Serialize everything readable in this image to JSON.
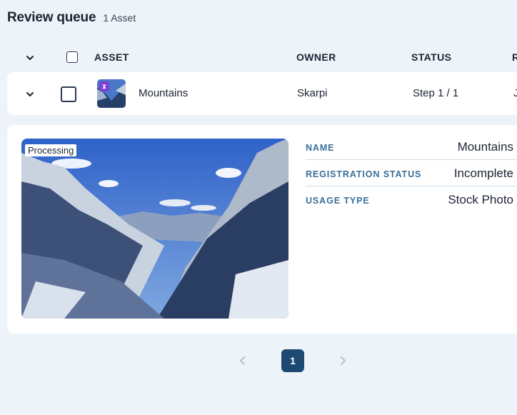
{
  "header": {
    "title": "Review queue",
    "count": "1 Asset"
  },
  "table": {
    "columns": [
      "ASSET",
      "OWNER",
      "STATUS",
      "R"
    ],
    "rows": [
      {
        "asset_name": "Mountains",
        "owner": "Skarpi",
        "status": "Step 1 / 1",
        "next_col_fragment": "J",
        "badge_icon": "hourglass-icon"
      }
    ]
  },
  "detail": {
    "processing_label": "Processing",
    "fields": [
      {
        "key": "NAME",
        "value": "Mountains"
      },
      {
        "key": "REGISTRATION STATUS",
        "value": "Incomplete"
      },
      {
        "key": "USAGE TYPE",
        "value": "Stock Photo"
      }
    ]
  },
  "pagination": {
    "current_page": "1"
  },
  "colors": {
    "accent": "#1e4a72",
    "label_blue": "#3a6f9a",
    "badge_purple": "#7b3fd6",
    "background": "#eef3f9"
  }
}
